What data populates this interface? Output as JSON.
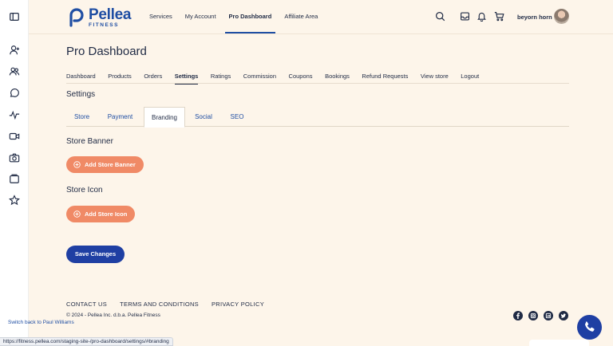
{
  "brand": {
    "name": "Pellea",
    "sub": "FITNESS",
    "color": "#1f4ea3"
  },
  "main_nav": [
    {
      "label": "Services",
      "active": false
    },
    {
      "label": "My Account",
      "active": false
    },
    {
      "label": "Pro Dashboard",
      "active": true
    },
    {
      "label": "Affiliate Area",
      "active": false
    }
  ],
  "header_icons": [
    "search-icon",
    "inbox-icon",
    "bell-icon",
    "cart-icon"
  ],
  "user": {
    "name": "beyorn horn"
  },
  "sidebar_icons": [
    "sidebar-toggle-icon",
    "user-add-icon",
    "users-icon",
    "chat-icon",
    "activity-icon",
    "video-icon",
    "camera-icon",
    "gallery-icon",
    "star-icon"
  ],
  "page": {
    "title": "Pro Dashboard"
  },
  "sub_nav": [
    {
      "label": "Dashboard",
      "active": false
    },
    {
      "label": "Products",
      "active": false
    },
    {
      "label": "Orders",
      "active": false
    },
    {
      "label": "Settings",
      "active": true
    },
    {
      "label": "Ratings",
      "active": false
    },
    {
      "label": "Commission",
      "active": false
    },
    {
      "label": "Coupons",
      "active": false
    },
    {
      "label": "Bookings",
      "active": false
    },
    {
      "label": "Refund Requests",
      "active": false
    },
    {
      "label": "View store",
      "active": false
    },
    {
      "label": "Logout",
      "active": false
    }
  ],
  "settings": {
    "title": "Settings",
    "tabs": [
      {
        "label": "Store",
        "active": false
      },
      {
        "label": "Payment",
        "active": false
      },
      {
        "label": "Branding",
        "active": true
      },
      {
        "label": "Social",
        "active": false
      },
      {
        "label": "SEO",
        "active": false
      }
    ],
    "banner": {
      "title": "Store Banner",
      "button": "Add Store Banner"
    },
    "icon": {
      "title": "Store Icon",
      "button": "Add Store Icon"
    },
    "save_label": "Save Changes"
  },
  "footer": {
    "links": [
      "CONTACT US",
      "TERMS AND CONDITIONS",
      "PRIVACY POLICY"
    ],
    "copyright": "© 2024 - Pellea Inc. d.b.a. Pellea Fitness",
    "social_icons": [
      "facebook-icon",
      "instagram-icon",
      "linkedin-icon",
      "twitter-icon"
    ]
  },
  "switch_back": "Switch back to Paul Williams",
  "status_url": "https://fitness.pellea.com/staging-site-/pro-dashboard/settings/#branding",
  "colors": {
    "accent": "#1f3fa3",
    "orange": "#f08a66",
    "background": "#fdf5ea"
  }
}
